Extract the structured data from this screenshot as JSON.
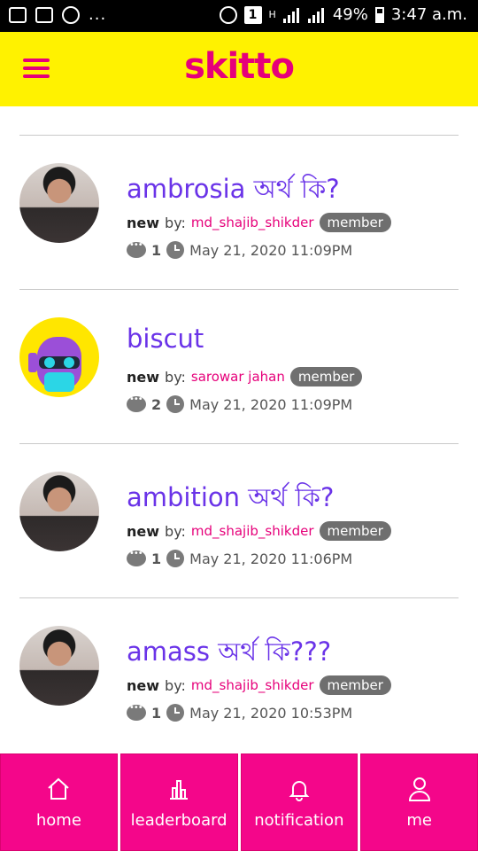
{
  "status_bar": {
    "battery": "49%",
    "time": "3:47 a.m.",
    "sim_badge": "1",
    "network": "H",
    "more": "..."
  },
  "app": {
    "logo": "skitto",
    "brand_color": "#e6007a",
    "topbar_color": "#fff200"
  },
  "posts": [
    {
      "title": "ambrosia অর্থ কি?",
      "status": "new",
      "by_label": "by:",
      "author": "md_shajib_shikder",
      "role": "member",
      "comments": "1",
      "date": "May 21, 2020 11:09PM",
      "avatar": "person-photo"
    },
    {
      "title": "biscut",
      "status": "new",
      "by_label": "by:",
      "author": "sarowar jahan",
      "role": "member",
      "comments": "2",
      "date": "May 21, 2020 11:09PM",
      "avatar": "robot-avatar"
    },
    {
      "title": "ambition অর্থ কি?",
      "status": "new",
      "by_label": "by:",
      "author": "md_shajib_shikder",
      "role": "member",
      "comments": "1",
      "date": "May 21, 2020 11:06PM",
      "avatar": "person-photo"
    },
    {
      "title": "amass অর্থ কি???",
      "status": "new",
      "by_label": "by:",
      "author": "md_shajib_shikder",
      "role": "member",
      "comments": "1",
      "date": "May 21, 2020 10:53PM",
      "avatar": "person-photo"
    }
  ],
  "nav": {
    "home": "home",
    "leaderboard": "leaderboard",
    "notification": "notification",
    "me": "me"
  }
}
